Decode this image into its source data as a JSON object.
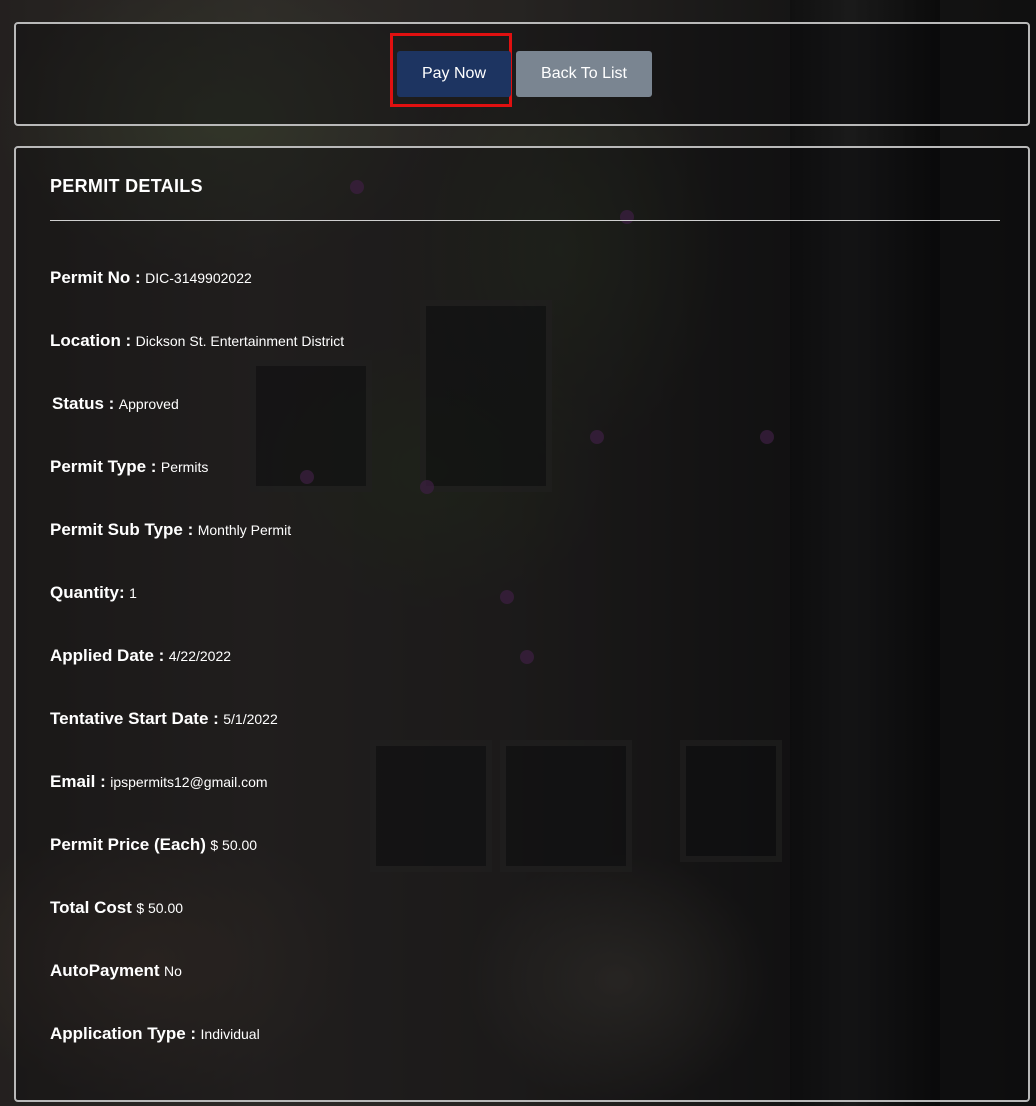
{
  "actions": {
    "pay_now_label": "Pay Now",
    "back_to_list_label": "Back To List"
  },
  "permit_details": {
    "title": "PERMIT DETAILS",
    "rows": [
      {
        "key": "Permit No :",
        "value": "DIC-3149902022"
      },
      {
        "key": "Location :",
        "value": "Dickson St. Entertainment District"
      },
      {
        "key": "Status :",
        "value": "Approved"
      },
      {
        "key": "Permit Type :",
        "value": "Permits"
      },
      {
        "key": "Permit Sub Type :",
        "value": "Monthly Permit"
      },
      {
        "key": "Quantity:",
        "value": "1"
      },
      {
        "key": "Applied Date :",
        "value": "4/22/2022"
      },
      {
        "key": "Tentative Start Date :",
        "value": "5/1/2022"
      },
      {
        "key": "Email :",
        "value": "ipspermits12@gmail.com"
      },
      {
        "key": "Permit Price (Each)",
        "value": "$ 50.00"
      },
      {
        "key": "Total Cost",
        "value": "$ 50.00"
      },
      {
        "key": "AutoPayment",
        "value": "No"
      },
      {
        "key": "Application Type :",
        "value": "Individual"
      }
    ]
  },
  "colors": {
    "pay_now_bg": "#1d3461",
    "back_to_list_bg": "#7a8591",
    "highlight_border": "#e01010"
  }
}
